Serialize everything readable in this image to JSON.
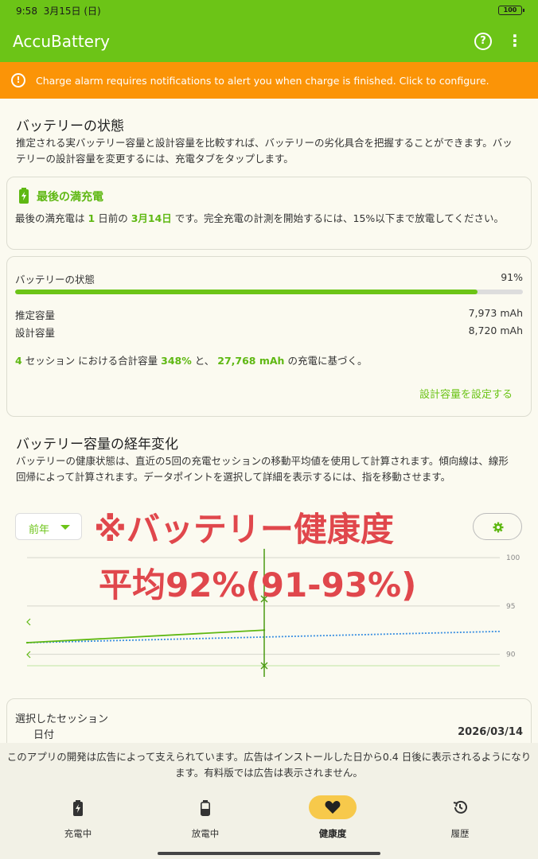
{
  "status_bar": {
    "time": "9:58",
    "date": "3月15日 (日)",
    "battery": "100"
  },
  "app_bar": {
    "title": "AccuBattery",
    "help_icon": "help-circle-icon",
    "more_icon": "more-vert-icon"
  },
  "alarm_banner": {
    "text": "Charge alarm requires notifications to alert you when charge is finished. Click to configure.",
    "icon": "alert-circle-icon"
  },
  "health_section": {
    "title": "バッテリーの状態",
    "description": "推定される実バッテリー容量と設計容量を比較すれば、バッテリーの劣化具合を把握することができます。バッテリーの設計容量を変更するには、充電タブをタップします。"
  },
  "last_full_charge": {
    "title": "最後の満充電",
    "icon": "battery-charging-icon",
    "text_pre": "最後の満充電は",
    "days": "1",
    "text_mid": "日前の",
    "date": "3月14日",
    "text_post": "です。完全充電の計測を開始するには、15%以下まで放電してください。"
  },
  "health_card": {
    "label": "バッテリーの状態",
    "value": "91%",
    "progress": 0.91,
    "estimated_capacity_label": "推定容量",
    "estimated_capacity_value": "7,973 mAh",
    "design_capacity_label": "設計容量",
    "design_capacity_value": "8,720 mAh",
    "sessions": "4",
    "sessions_text": "セッション における合計容量",
    "total_percent": "348%",
    "and_text": "と、",
    "total_mah": "27,768 mAh",
    "based_text": "の充電に基づく。",
    "set_design_capacity": "設計容量を設定する"
  },
  "trend_section": {
    "title": "バッテリー容量の経年変化",
    "description": "バッテリーの健康状態は、直近の5回の充電セッションの移動平均値を使用して計算されます。傾向線は、線形回帰によって計算されます。データポイントを選択して詳細を表示するには、指を移動させます。",
    "period": "前年",
    "settings_icon": "gear-icon"
  },
  "overlay": {
    "line1": "※バッテリー健康度",
    "line2": "平均92%(91-93%)"
  },
  "chart_data": {
    "type": "line",
    "y_ticks": [
      "100",
      "95",
      "90"
    ],
    "ylim": [
      87.5,
      100.5
    ],
    "x": [
      0,
      1
    ],
    "series": [
      {
        "values": [
          91.2,
          92.5
        ],
        "color": "#5fb813"
      },
      {
        "values": [
          91.2,
          92.5
        ],
        "color": "#3a8fe0"
      }
    ],
    "selected_x": 1
  },
  "selected_session": {
    "title": "選択したセッション",
    "date_label": "日付",
    "date_value": "2026/03/14"
  },
  "ad_text": "このアプリの開発は広告によって支えられています。広告はインストールした日から0.4 日後に表示されるようになります。有料版では広告は表示されません。",
  "nav": [
    {
      "label": "充電中",
      "icon": "battery-charging-icon"
    },
    {
      "label": "放電中",
      "icon": "battery-discharging-icon"
    },
    {
      "label": "健康度",
      "icon": "heart-icon"
    },
    {
      "label": "履歴",
      "icon": "history-icon"
    }
  ]
}
